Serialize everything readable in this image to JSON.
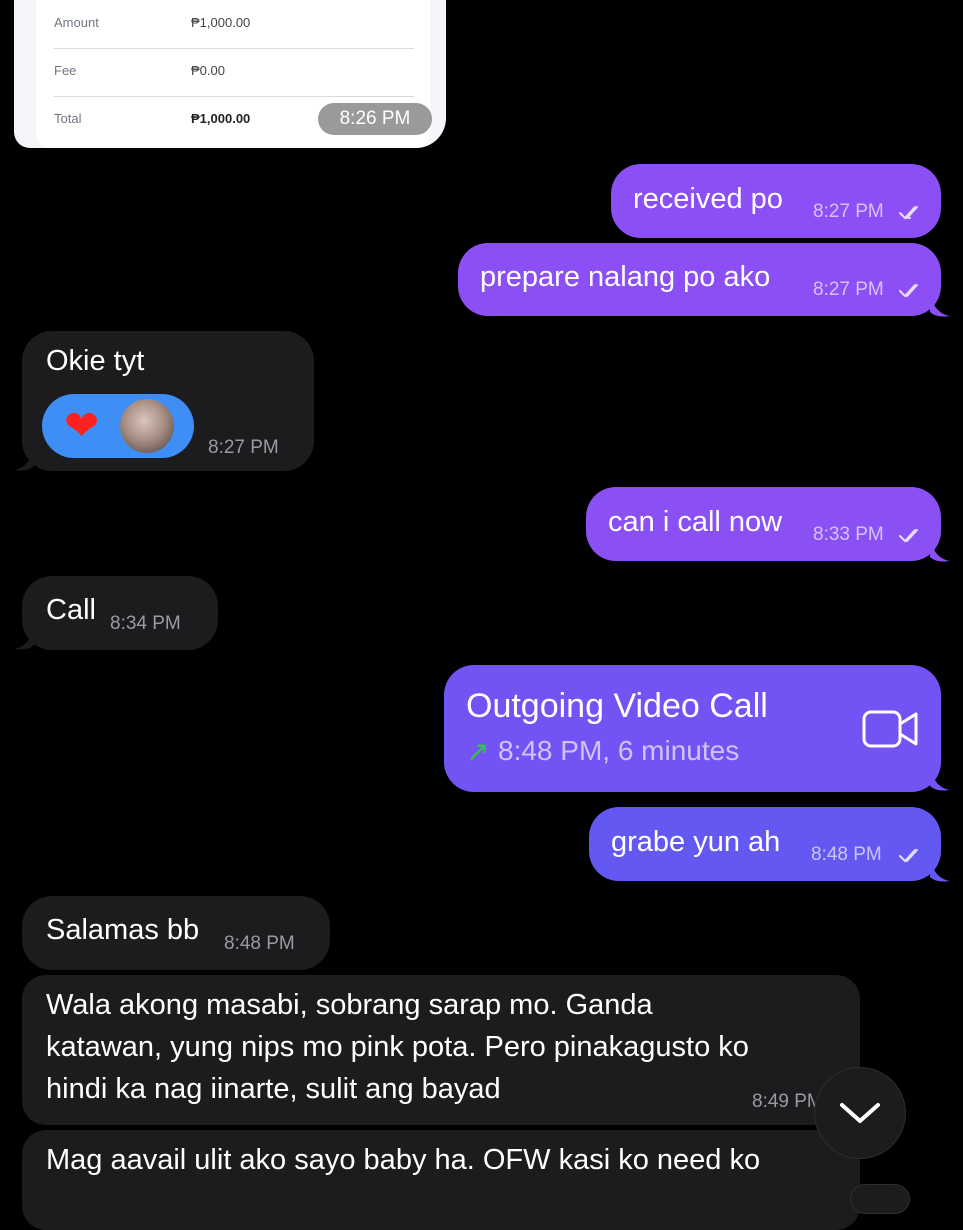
{
  "receipt": {
    "rows": [
      {
        "label": "Amount",
        "value": "₱1,000.00"
      },
      {
        "label": "Fee",
        "value": "₱0.00"
      },
      {
        "label": "Total",
        "value": "₱1,000.00"
      }
    ],
    "time": "8:26 PM"
  },
  "messages": [
    {
      "id": "m1",
      "direction": "outgoing",
      "text": "received po",
      "time": "8:27 PM"
    },
    {
      "id": "m2",
      "direction": "outgoing",
      "text": "prepare nalang po ako",
      "time": "8:27 PM"
    },
    {
      "id": "m3",
      "direction": "incoming",
      "text": "Okie tyt",
      "time": "8:27 PM",
      "reaction": {
        "emoji": "❤"
      }
    },
    {
      "id": "m4",
      "direction": "outgoing",
      "text": "can i call now",
      "time": "8:33 PM"
    },
    {
      "id": "m5",
      "direction": "incoming",
      "text": "Call",
      "time": "8:34 PM"
    },
    {
      "id": "m6",
      "direction": "outgoing",
      "type": "call",
      "title": "Outgoing Video Call",
      "arrow": "↗",
      "detail": "8:48 PM, 6 minutes",
      "icon": "video-camera-icon"
    },
    {
      "id": "m7",
      "direction": "outgoing",
      "text": "grabe yun ah",
      "time": "8:48 PM"
    },
    {
      "id": "m8",
      "direction": "incoming",
      "text": "Salamas bb",
      "time": "8:48 PM"
    },
    {
      "id": "m9",
      "direction": "incoming",
      "lines": [
        "Wala akong masabi, sobrang sarap mo. Ganda",
        "katawan, yung nips mo pink pota. Pero pinakagusto ko",
        "hindi ka nag iinarte, sulit ang bayad"
      ],
      "time": "8:49 PM"
    },
    {
      "id": "m10",
      "direction": "incoming",
      "text": "Mag aavail ulit ako sayo baby ha. OFW kasi ko need ko"
    }
  ],
  "colors": {
    "background": "#000000",
    "incoming": "#1c1c1e",
    "outgoing_top": "#8c4ff5",
    "outgoing_bottom": "#6458f2",
    "reaction": "#3e8ef5",
    "call_arrow": "#33c24d"
  },
  "icons": [
    "double-check-icon",
    "video-camera-icon",
    "chevron-down-icon",
    "heart-icon"
  ]
}
